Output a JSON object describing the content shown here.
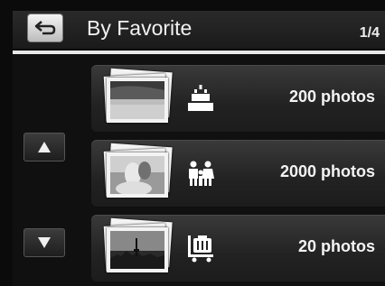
{
  "header": {
    "title": "By Favorite",
    "page_indicator": "1/4"
  },
  "rows": [
    {
      "label": "200 photos",
      "icon": "birthday-cake-icon"
    },
    {
      "label": "2000 photos",
      "icon": "family-icon"
    },
    {
      "label": "20 photos",
      "icon": "luggage-cart-icon"
    }
  ],
  "nav": {
    "up_icon": "up-arrow-icon",
    "down_icon": "down-arrow-icon"
  }
}
